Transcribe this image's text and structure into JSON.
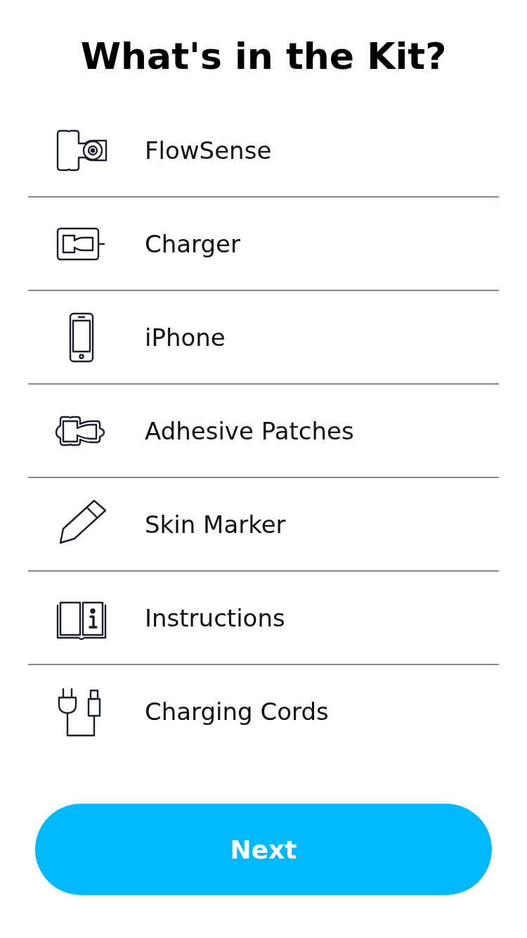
{
  "title": "What's in the Kit?",
  "items": [
    {
      "kind": "sensor",
      "label": "FlowSense"
    },
    {
      "kind": "charger",
      "label": "Charger"
    },
    {
      "kind": "phone",
      "label": "iPhone"
    },
    {
      "kind": "patch",
      "label": "Adhesive Patches"
    },
    {
      "kind": "marker",
      "label": "Skin Marker"
    },
    {
      "kind": "manual",
      "label": "Instructions"
    },
    {
      "kind": "cords",
      "label": "Charging Cords"
    }
  ],
  "button": "Next"
}
